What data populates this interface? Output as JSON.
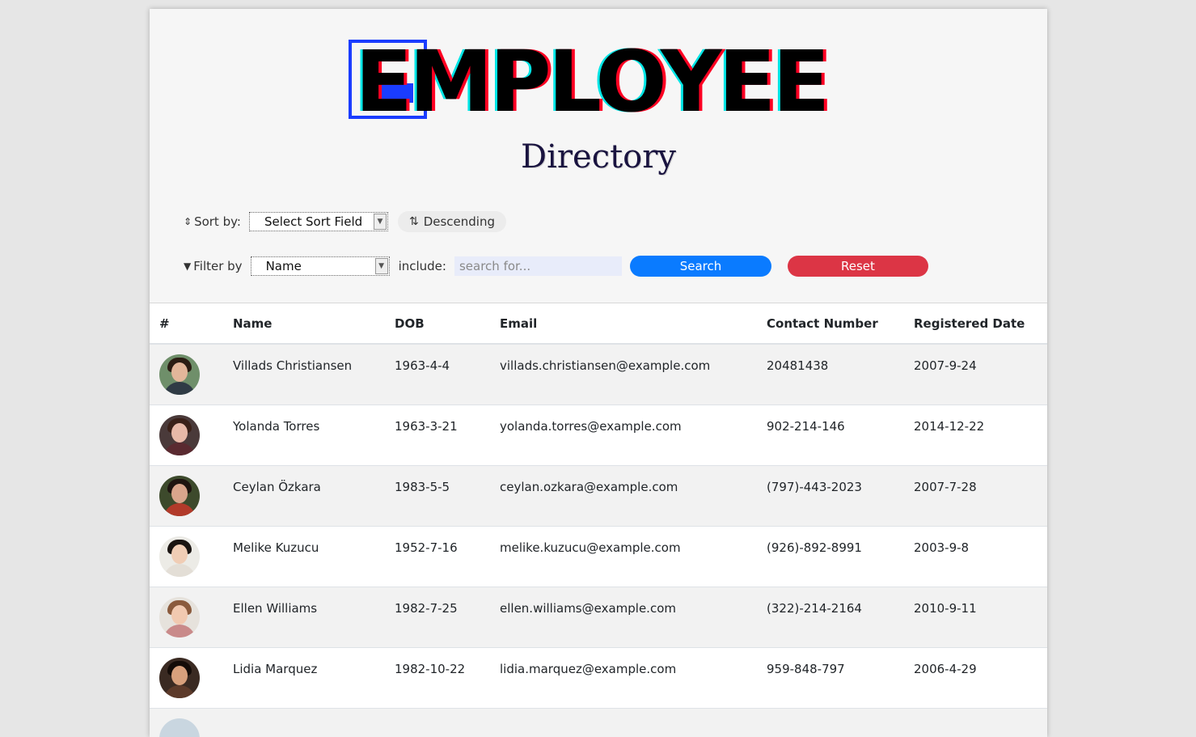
{
  "header": {
    "logo_text": "EMPLOYEE",
    "subtitle": "Directory"
  },
  "controls": {
    "sort_label": "Sort by:",
    "sort_select_value": "Select Sort Field",
    "order_button_label": "Descending",
    "filter_label": "Filter by",
    "filter_select_value": "Name",
    "include_label": "include:",
    "search_placeholder": "search for...",
    "search_button_label": "Search",
    "reset_button_label": "Reset"
  },
  "colors": {
    "search_button": "#0a7bff",
    "reset_button": "#dc3545",
    "logo_blue": "#1a3cff",
    "logo_red": "#ff0022",
    "logo_cyan": "#00e5e5"
  },
  "table": {
    "columns": [
      "#",
      "Name",
      "DOB",
      "Email",
      "Contact Number",
      "Registered Date"
    ],
    "rows": [
      {
        "name": "Villads Christiansen",
        "dob": "1963-4-4",
        "email": "villads.christiansen@example.com",
        "phone": "20481438",
        "registered": "2007-9-24"
      },
      {
        "name": "Yolanda Torres",
        "dob": "1963-3-21",
        "email": "yolanda.torres@example.com",
        "phone": "902-214-146",
        "registered": "2014-12-22"
      },
      {
        "name": "Ceylan Özkara",
        "dob": "1983-5-5",
        "email": "ceylan.ozkara@example.com",
        "phone": "(797)-443-2023",
        "registered": "2007-7-28"
      },
      {
        "name": "Melike Kuzucu",
        "dob": "1952-7-16",
        "email": "melike.kuzucu@example.com",
        "phone": "(926)-892-8991",
        "registered": "2003-9-8"
      },
      {
        "name": "Ellen Williams",
        "dob": "1982-7-25",
        "email": "ellen.williams@example.com",
        "phone": "(322)-214-2164",
        "registered": "2010-9-11"
      },
      {
        "name": "Lidia Marquez",
        "dob": "1982-10-22",
        "email": "lidia.marquez@example.com",
        "phone": "959-848-797",
        "registered": "2006-4-29"
      }
    ]
  }
}
